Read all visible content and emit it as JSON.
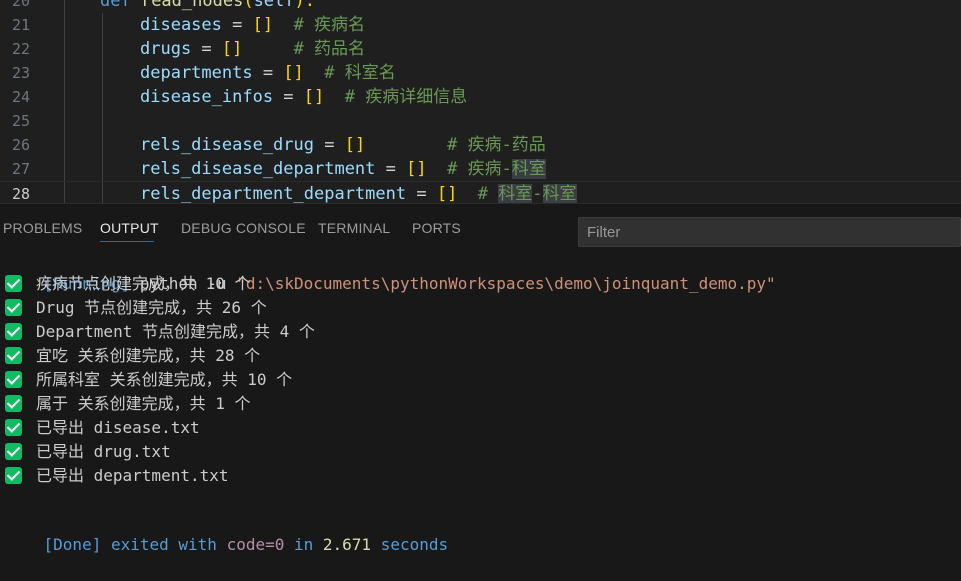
{
  "editor": {
    "lines": [
      {
        "num": "20",
        "parts": [
          {
            "t": "def ",
            "c": "kw"
          },
          {
            "t": "read_nodes",
            "c": "fn"
          },
          {
            "t": "(",
            "c": "b"
          },
          {
            "t": "self",
            "c": "v"
          },
          {
            "t": "):",
            "c": "b"
          }
        ],
        "indent": 100
      },
      {
        "num": "21",
        "parts": [
          {
            "t": "diseases",
            "c": "v"
          },
          {
            "t": " = ",
            "c": "o"
          },
          {
            "t": "[]",
            "c": "b"
          },
          {
            "t": "  # 疾病名",
            "c": "c"
          }
        ]
      },
      {
        "num": "22",
        "parts": [
          {
            "t": "drugs",
            "c": "v"
          },
          {
            "t": " = ",
            "c": "o"
          },
          {
            "t": "[]",
            "c": "b"
          },
          {
            "t": "     # 药品名",
            "c": "c"
          }
        ]
      },
      {
        "num": "23",
        "parts": [
          {
            "t": "departments",
            "c": "v"
          },
          {
            "t": " = ",
            "c": "o"
          },
          {
            "t": "[]",
            "c": "b"
          },
          {
            "t": "  # 科室名",
            "c": "c"
          }
        ]
      },
      {
        "num": "24",
        "parts": [
          {
            "t": "disease_infos",
            "c": "v"
          },
          {
            "t": " = ",
            "c": "o"
          },
          {
            "t": "[]",
            "c": "b"
          },
          {
            "t": "  # 疾病详细信息",
            "c": "c"
          }
        ]
      },
      {
        "num": "25",
        "parts": []
      },
      {
        "num": "26",
        "parts": [
          {
            "t": "rels_disease_drug",
            "c": "v"
          },
          {
            "t": " = ",
            "c": "o"
          },
          {
            "t": "[]",
            "c": "b"
          },
          {
            "t": "        # 疾病-药品",
            "c": "c"
          }
        ]
      },
      {
        "num": "27",
        "parts": [
          {
            "t": "rels_disease_department",
            "c": "v"
          },
          {
            "t": " = ",
            "c": "o"
          },
          {
            "t": "[]",
            "c": "b"
          },
          {
            "t": "  # 疾病-",
            "c": "c"
          },
          {
            "t": "科室",
            "c": "c hl"
          }
        ]
      },
      {
        "num": "28",
        "parts": [
          {
            "t": "rels_department_department",
            "c": "v"
          },
          {
            "t": " = ",
            "c": "o"
          },
          {
            "t": "[]",
            "c": "b"
          },
          {
            "t": "  # ",
            "c": "c"
          },
          {
            "t": "科室",
            "c": "c hl"
          },
          {
            "t": "-",
            "c": "c"
          },
          {
            "t": "科室",
            "c": "c hl"
          }
        ],
        "active": true
      }
    ]
  },
  "panel": {
    "tabs": [
      {
        "label": "PROBLEMS",
        "active": false
      },
      {
        "label": "OUTPUT",
        "active": true
      },
      {
        "label": "DEBUG CONSOLE",
        "active": false
      },
      {
        "label": "TERMINAL",
        "active": false
      },
      {
        "label": "PORTS",
        "active": false
      }
    ],
    "filter_placeholder": "Filter"
  },
  "output": {
    "running_tag": "[Running]",
    "command": " python -u ",
    "command_path": "\"d:\\skDocuments\\pythonWorkspaces\\demo\\joinquant_demo.py\"",
    "messages": [
      "疾病节点创建完成，共 10 个",
      "Drug 节点创建完成，共 26 个",
      "Department 节点创建完成，共 4 个",
      "宜吃 关系创建完成，共 28 个",
      "所属科室 关系创建完成，共 10 个",
      "属于 关系创建完成，共 1 个",
      "已导出 disease.txt",
      "已导出 drug.txt",
      "已导出 department.txt"
    ],
    "done_tag": "[Done]",
    "done_exited": " exited with ",
    "done_code": "code=0",
    "done_in": " in ",
    "done_time": "2.671",
    "done_seconds": " seconds"
  },
  "colors": {
    "accent": "#0078d4",
    "check": "#0fbb63"
  },
  "icons": {
    "success": "check-icon"
  }
}
